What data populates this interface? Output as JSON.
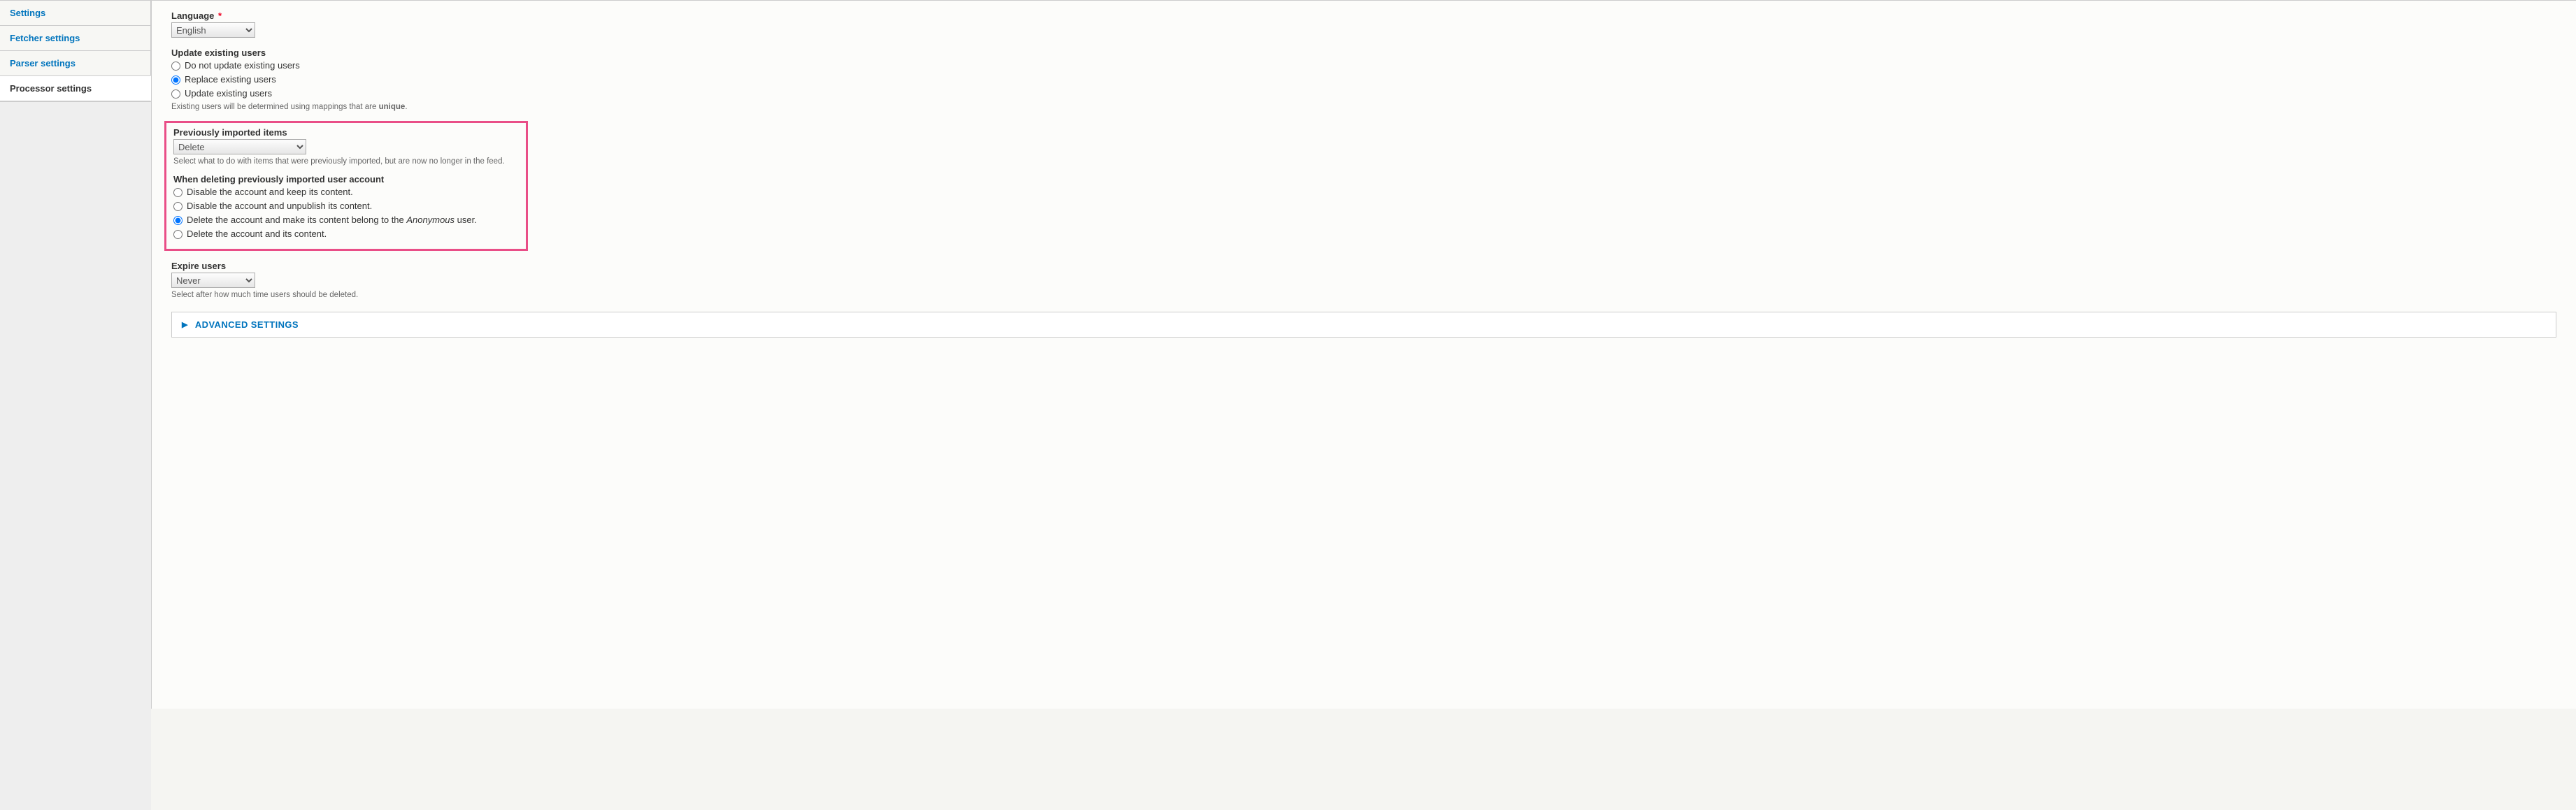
{
  "sidebar": {
    "tabs": [
      {
        "label": "Settings",
        "active": false
      },
      {
        "label": "Fetcher settings",
        "active": false
      },
      {
        "label": "Parser settings",
        "active": false
      },
      {
        "label": "Processor settings",
        "active": true
      }
    ]
  },
  "form": {
    "language": {
      "label": "Language",
      "required": true,
      "value": "English"
    },
    "update_existing": {
      "label": "Update existing users",
      "options": [
        "Do not update existing users",
        "Replace existing users",
        "Update existing users"
      ],
      "selected_index": 1,
      "description_prefix": "Existing users will be determined using mappings that are ",
      "description_bold": "unique",
      "description_suffix": "."
    },
    "previously_imported": {
      "label": "Previously imported items",
      "value": "Delete",
      "description": "Select what to do with items that were previously imported, but are now no longer in the feed."
    },
    "when_deleting": {
      "label": "When deleting previously imported user account",
      "options": [
        "Disable the account and keep its content.",
        "Disable the account and unpublish its content.",
        "Delete the account and make its content belong to the |Anonymous| user.",
        "Delete the account and its content."
      ],
      "selected_index": 2
    },
    "expire": {
      "label": "Expire users",
      "value": "Never",
      "description": "Select after how much time users should be deleted."
    },
    "advanced": {
      "label": "ADVANCED SETTINGS"
    }
  }
}
